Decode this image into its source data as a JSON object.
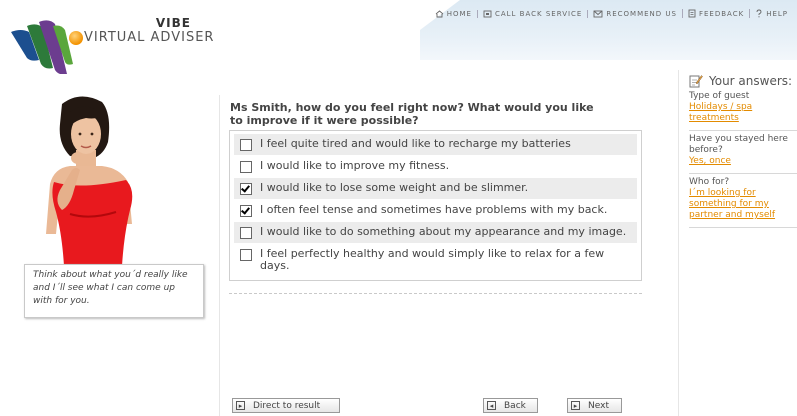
{
  "header": {
    "brand_top": "VIBE",
    "brand_bottom": "VIRTUAL ADVISER",
    "nav": [
      {
        "label": "HOME",
        "icon": "home-icon"
      },
      {
        "label": "CALL BACK SERVICE",
        "icon": "phone-icon"
      },
      {
        "label": "RECOMMEND US",
        "icon": "envelope-icon"
      },
      {
        "label": "FEEDBACK",
        "icon": "document-icon"
      },
      {
        "label": "HELP",
        "icon": "help-icon"
      }
    ]
  },
  "advisor": {
    "tip": "Think about what you´d really like and I´ll see what I can come up with for you."
  },
  "question": "Ms Smith, how do you feel right now? What would you like to improve if it were possible?",
  "options": [
    {
      "label": "I feel quite tired and would like to recharge my batteries",
      "checked": false
    },
    {
      "label": "I would like to improve my fitness.",
      "checked": false
    },
    {
      "label": "I would like to lose some weight and be slimmer.",
      "checked": true
    },
    {
      "label": "I often feel tense and sometimes have problems with my back.",
      "checked": true
    },
    {
      "label": "I would like to do something about my appearance and my image.",
      "checked": false
    },
    {
      "label": "I feel perfectly healthy and would simply like to relax for a few days.",
      "checked": false
    }
  ],
  "buttons": {
    "direct": "Direct to result",
    "back": "Back",
    "next": "Next"
  },
  "answers": {
    "title": "Your answers:",
    "items": [
      {
        "label": "Type of guest",
        "value": "Holidays / spa treatments"
      },
      {
        "label": "Have you stayed here before?",
        "value": "Yes, once"
      },
      {
        "label": "Who for?",
        "value": "I´m looking for something for my partner and myself"
      }
    ]
  },
  "colors": {
    "accent_orange": "#e38b00",
    "header_blue": "#dce9f3",
    "dress_red": "#e8191e"
  }
}
